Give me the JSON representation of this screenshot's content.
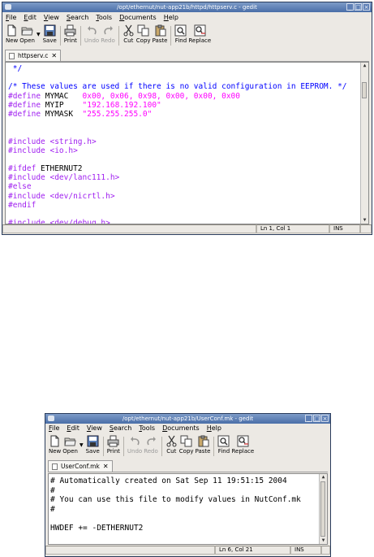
{
  "window1": {
    "title": "/opt/ethernut/nut-app21b/httpd/httpserv.c - gedit",
    "menu": [
      "File",
      "Edit",
      "View",
      "Search",
      "Tools",
      "Documents",
      "Help"
    ],
    "toolbar": {
      "new": "New",
      "open": "Open",
      "save": "Save",
      "print": "Print",
      "undo": "Undo",
      "redo": "Redo",
      "cut": "Cut",
      "copy": "Copy",
      "paste": "Paste",
      "find": "Find",
      "replace": "Replace"
    },
    "tab": "httpserv.c",
    "lines": [
      [
        {
          "t": " */",
          "c": "c-comment"
        }
      ],
      [
        {
          "t": "",
          "c": ""
        }
      ],
      [
        {
          "t": "/* These values are used if there is no valid configuration in EEPROM. */",
          "c": "c-comment"
        }
      ],
      [
        {
          "t": "#define",
          "c": "c-pre"
        },
        {
          "t": " MYMAC   ",
          "c": ""
        },
        {
          "t": "0x00, 0x06, 0x98, 0x00, 0x00, 0x00",
          "c": "c-num"
        }
      ],
      [
        {
          "t": "#define",
          "c": "c-pre"
        },
        {
          "t": " MYIP    ",
          "c": ""
        },
        {
          "t": "\"192.168.192.100\"",
          "c": "c-str"
        }
      ],
      [
        {
          "t": "#define",
          "c": "c-pre"
        },
        {
          "t": " MYMASK  ",
          "c": ""
        },
        {
          "t": "\"255.255.255.0\"",
          "c": "c-str"
        }
      ],
      [
        {
          "t": "",
          "c": ""
        }
      ],
      [
        {
          "t": "",
          "c": ""
        }
      ],
      [
        {
          "t": "#include <string.h>",
          "c": "c-pre"
        }
      ],
      [
        {
          "t": "#include <io.h>",
          "c": "c-pre"
        }
      ],
      [
        {
          "t": "",
          "c": ""
        }
      ],
      [
        {
          "t": "#ifdef",
          "c": "c-pre"
        },
        {
          "t": " ETHERNUT2",
          "c": ""
        }
      ],
      [
        {
          "t": "#include <dev/lanc111.h>",
          "c": "c-pre"
        }
      ],
      [
        {
          "t": "#else",
          "c": "c-pre"
        }
      ],
      [
        {
          "t": "#include <dev/nicrtl.h>",
          "c": "c-pre"
        }
      ],
      [
        {
          "t": "#endif",
          "c": "c-pre"
        }
      ],
      [
        {
          "t": "",
          "c": ""
        }
      ],
      [
        {
          "t": "#include <dev/debug.h>",
          "c": "c-pre"
        }
      ]
    ],
    "status": {
      "position": "Ln 1, Col 1",
      "mode": "INS"
    }
  },
  "window2": {
    "title": "/opt/ethernut/nut-app21b/UserConf.mk - gedit",
    "menu": [
      "File",
      "Edit",
      "View",
      "Search",
      "Tools",
      "Documents",
      "Help"
    ],
    "toolbar": {
      "new": "New",
      "open": "Open",
      "save": "Save",
      "print": "Print",
      "undo": "Undo",
      "redo": "Redo",
      "cut": "Cut",
      "copy": "Copy",
      "paste": "Paste",
      "find": "Find",
      "replace": "Replace"
    },
    "tab": "UserConf.mk",
    "lines": [
      "# Automatically created on Sat Sep 11 19:51:15 2004",
      "#",
      "# You can use this file to modify values in NutConf.mk",
      "#",
      "",
      "HWDEF += -DETHERNUT2"
    ],
    "status": {
      "position": "Ln 6, Col 21",
      "mode": "INS"
    }
  },
  "icons": [
    "new-icon",
    "open-icon",
    "save-icon",
    "print-icon",
    "undo-icon",
    "redo-icon",
    "cut-icon",
    "copy-icon",
    "paste-icon",
    "find-icon",
    "replace-icon"
  ]
}
